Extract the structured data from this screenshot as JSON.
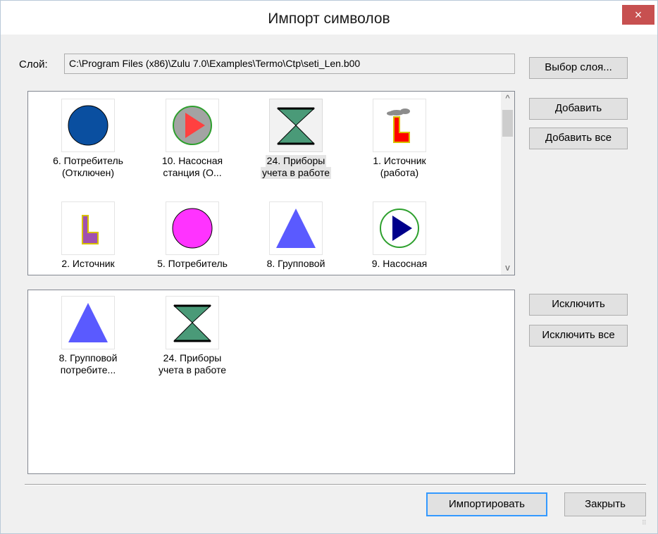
{
  "window": {
    "title": "Импорт символов",
    "close_glyph": "×"
  },
  "layer": {
    "label": "Слой:",
    "path": "C:\\Program Files (x86)\\Zulu 7.0\\Examples\\Termo\\Ctp\\seti_Len.b00",
    "choose_button": "Выбор слоя..."
  },
  "available": {
    "items": [
      {
        "line1": "6. Потребитель",
        "line2": "(Отключен)",
        "icon": "dark-blue-circle-icon"
      },
      {
        "line1": "10. Насосная",
        "line2": "станция (О...",
        "icon": "pump-station-off-icon"
      },
      {
        "line1": "24. Приборы",
        "line2": "учета в работе",
        "icon": "hourglass-meter-icon",
        "selected": true
      },
      {
        "line1": "1. Источник",
        "line2": "(работа)",
        "icon": "factory-source-icon"
      },
      {
        "line1": "2. Источник",
        "line2": "",
        "icon": "factory-source-purple-icon"
      },
      {
        "line1": "5. Потребитель",
        "line2": "",
        "icon": "magenta-circle-icon"
      },
      {
        "line1": "8. Групповой",
        "line2": "",
        "icon": "blue-triangle-icon"
      },
      {
        "line1": "9. Насосная",
        "line2": "",
        "icon": "pump-station-icon"
      }
    ],
    "add_button": "Добавить",
    "add_all_button": "Добавить все"
  },
  "selected_list": {
    "items": [
      {
        "line1": "8. Групповой",
        "line2": "потребите...",
        "icon": "blue-triangle-icon"
      },
      {
        "line1": "24. Приборы",
        "line2": "учета в работе",
        "icon": "hourglass-meter-icon"
      }
    ],
    "exclude_button": "Исключить",
    "exclude_all_button": "Исключить все"
  },
  "footer": {
    "import_button": "Импортировать",
    "close_button": "Закрыть"
  },
  "scrollbar": {
    "up_glyph": "^",
    "down_glyph": "v"
  },
  "colors": {
    "consumer_off": "#0a4fa0",
    "pump_off_fill": "#a3a3a3",
    "pump_arrow": "#ff4040",
    "hourglass": "#4a9a78",
    "magenta": "#ff33ff",
    "triangle": "#5a5aff",
    "pump_arrow_on": "#00008b",
    "source_red": "#ff0000",
    "source_purple": "#a050b0"
  }
}
